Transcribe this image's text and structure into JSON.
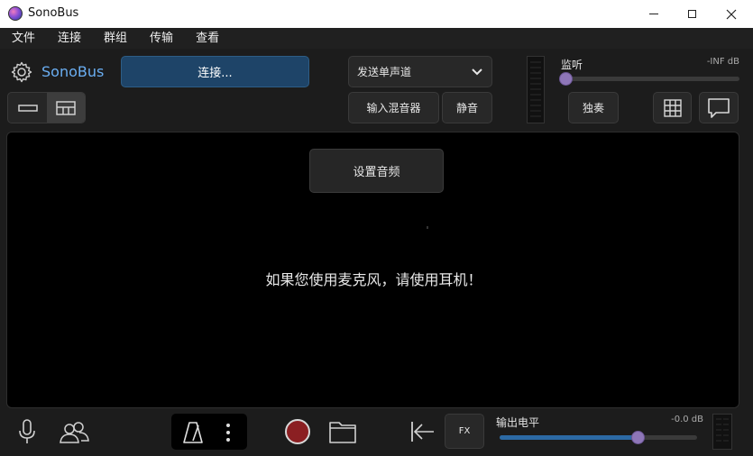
{
  "window": {
    "title": "SonoBus"
  },
  "menu": [
    "文件",
    "连接",
    "群组",
    "传输",
    "查看"
  ],
  "header": {
    "brand": "SonoBus",
    "connect_label": "连接...",
    "send_mode": "发送单声道",
    "input_mixer_label": "输入混音器",
    "mute_label": "静音",
    "monitor_label": "监听",
    "monitor_value": "-INF dB",
    "monitor_level": 0.0,
    "solo_label": "独奏"
  },
  "main": {
    "setup_audio_label": "设置音频",
    "message": "如果您使用麦克风，请使用耳机！"
  },
  "footer": {
    "fx_label": "FX",
    "output_label": "输出电平",
    "output_value": "-0.0 dB",
    "output_level": 0.7
  },
  "colors": {
    "accent": "#6aaef2",
    "connect_bg": "#1e4468",
    "slider_fill": "#2c6aa5",
    "slider_thumb": "#8e76b8",
    "record": "#8b1f22"
  }
}
